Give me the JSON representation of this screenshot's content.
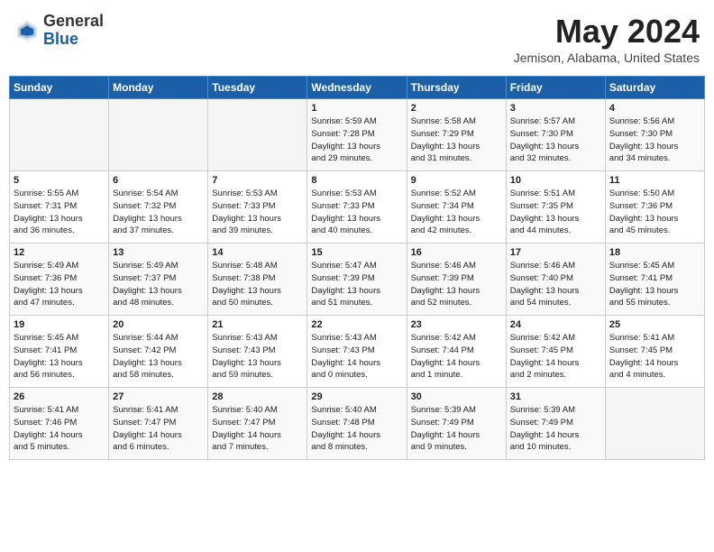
{
  "header": {
    "logo_general": "General",
    "logo_blue": "Blue",
    "title": "May 2024",
    "location": "Jemison, Alabama, United States"
  },
  "days_of_week": [
    "Sunday",
    "Monday",
    "Tuesday",
    "Wednesday",
    "Thursday",
    "Friday",
    "Saturday"
  ],
  "weeks": [
    [
      {
        "day": "",
        "info": ""
      },
      {
        "day": "",
        "info": ""
      },
      {
        "day": "",
        "info": ""
      },
      {
        "day": "1",
        "info": "Sunrise: 5:59 AM\nSunset: 7:28 PM\nDaylight: 13 hours\nand 29 minutes."
      },
      {
        "day": "2",
        "info": "Sunrise: 5:58 AM\nSunset: 7:29 PM\nDaylight: 13 hours\nand 31 minutes."
      },
      {
        "day": "3",
        "info": "Sunrise: 5:57 AM\nSunset: 7:30 PM\nDaylight: 13 hours\nand 32 minutes."
      },
      {
        "day": "4",
        "info": "Sunrise: 5:56 AM\nSunset: 7:30 PM\nDaylight: 13 hours\nand 34 minutes."
      }
    ],
    [
      {
        "day": "5",
        "info": "Sunrise: 5:55 AM\nSunset: 7:31 PM\nDaylight: 13 hours\nand 36 minutes."
      },
      {
        "day": "6",
        "info": "Sunrise: 5:54 AM\nSunset: 7:32 PM\nDaylight: 13 hours\nand 37 minutes."
      },
      {
        "day": "7",
        "info": "Sunrise: 5:53 AM\nSunset: 7:33 PM\nDaylight: 13 hours\nand 39 minutes."
      },
      {
        "day": "8",
        "info": "Sunrise: 5:53 AM\nSunset: 7:33 PM\nDaylight: 13 hours\nand 40 minutes."
      },
      {
        "day": "9",
        "info": "Sunrise: 5:52 AM\nSunset: 7:34 PM\nDaylight: 13 hours\nand 42 minutes."
      },
      {
        "day": "10",
        "info": "Sunrise: 5:51 AM\nSunset: 7:35 PM\nDaylight: 13 hours\nand 44 minutes."
      },
      {
        "day": "11",
        "info": "Sunrise: 5:50 AM\nSunset: 7:36 PM\nDaylight: 13 hours\nand 45 minutes."
      }
    ],
    [
      {
        "day": "12",
        "info": "Sunrise: 5:49 AM\nSunset: 7:36 PM\nDaylight: 13 hours\nand 47 minutes."
      },
      {
        "day": "13",
        "info": "Sunrise: 5:49 AM\nSunset: 7:37 PM\nDaylight: 13 hours\nand 48 minutes."
      },
      {
        "day": "14",
        "info": "Sunrise: 5:48 AM\nSunset: 7:38 PM\nDaylight: 13 hours\nand 50 minutes."
      },
      {
        "day": "15",
        "info": "Sunrise: 5:47 AM\nSunset: 7:39 PM\nDaylight: 13 hours\nand 51 minutes."
      },
      {
        "day": "16",
        "info": "Sunrise: 5:46 AM\nSunset: 7:39 PM\nDaylight: 13 hours\nand 52 minutes."
      },
      {
        "day": "17",
        "info": "Sunrise: 5:46 AM\nSunset: 7:40 PM\nDaylight: 13 hours\nand 54 minutes."
      },
      {
        "day": "18",
        "info": "Sunrise: 5:45 AM\nSunset: 7:41 PM\nDaylight: 13 hours\nand 55 minutes."
      }
    ],
    [
      {
        "day": "19",
        "info": "Sunrise: 5:45 AM\nSunset: 7:41 PM\nDaylight: 13 hours\nand 56 minutes."
      },
      {
        "day": "20",
        "info": "Sunrise: 5:44 AM\nSunset: 7:42 PM\nDaylight: 13 hours\nand 58 minutes."
      },
      {
        "day": "21",
        "info": "Sunrise: 5:43 AM\nSunset: 7:43 PM\nDaylight: 13 hours\nand 59 minutes."
      },
      {
        "day": "22",
        "info": "Sunrise: 5:43 AM\nSunset: 7:43 PM\nDaylight: 14 hours\nand 0 minutes."
      },
      {
        "day": "23",
        "info": "Sunrise: 5:42 AM\nSunset: 7:44 PM\nDaylight: 14 hours\nand 1 minute."
      },
      {
        "day": "24",
        "info": "Sunrise: 5:42 AM\nSunset: 7:45 PM\nDaylight: 14 hours\nand 2 minutes."
      },
      {
        "day": "25",
        "info": "Sunrise: 5:41 AM\nSunset: 7:45 PM\nDaylight: 14 hours\nand 4 minutes."
      }
    ],
    [
      {
        "day": "26",
        "info": "Sunrise: 5:41 AM\nSunset: 7:46 PM\nDaylight: 14 hours\nand 5 minutes."
      },
      {
        "day": "27",
        "info": "Sunrise: 5:41 AM\nSunset: 7:47 PM\nDaylight: 14 hours\nand 6 minutes."
      },
      {
        "day": "28",
        "info": "Sunrise: 5:40 AM\nSunset: 7:47 PM\nDaylight: 14 hours\nand 7 minutes."
      },
      {
        "day": "29",
        "info": "Sunrise: 5:40 AM\nSunset: 7:48 PM\nDaylight: 14 hours\nand 8 minutes."
      },
      {
        "day": "30",
        "info": "Sunrise: 5:39 AM\nSunset: 7:49 PM\nDaylight: 14 hours\nand 9 minutes."
      },
      {
        "day": "31",
        "info": "Sunrise: 5:39 AM\nSunset: 7:49 PM\nDaylight: 14 hours\nand 10 minutes."
      },
      {
        "day": "",
        "info": ""
      }
    ]
  ]
}
